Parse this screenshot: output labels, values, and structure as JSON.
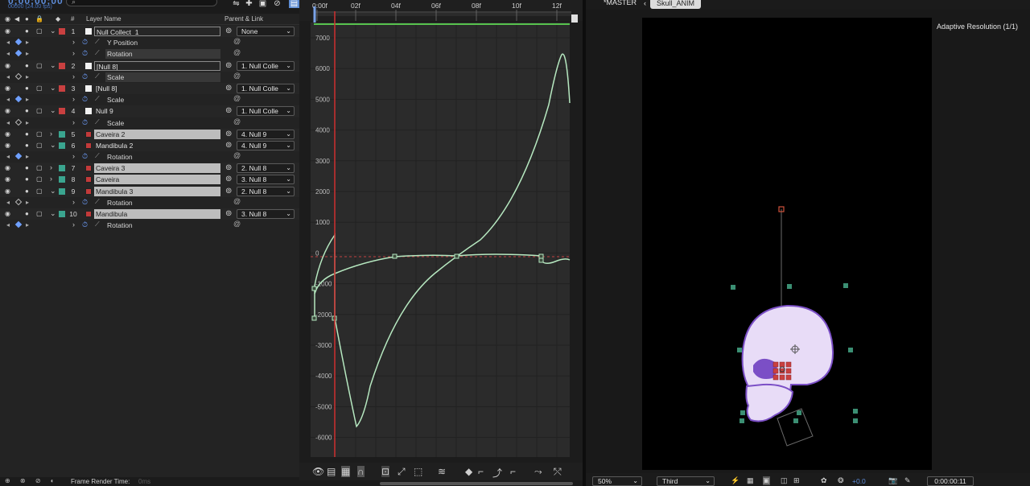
{
  "timeline": {
    "timecode": "0;00;00;00",
    "fps": "00000 (24.00 fps)",
    "search_placeholder": "",
    "search_icon_glyph": "⌕",
    "header": {
      "num": "#",
      "layer_name": "Layer Name",
      "parent_link": "Parent & Link"
    },
    "layers": [
      {
        "kind": "layer",
        "num": "1",
        "name": "Null Collect_1",
        "label_color": "#c94040",
        "type": "null",
        "expanded": true,
        "name_style": "boxed",
        "parent": "None"
      },
      {
        "kind": "prop",
        "name": "Y Position",
        "kf": "filled"
      },
      {
        "kind": "prop",
        "name": "Rotation",
        "kf": "filled",
        "dark": true
      },
      {
        "kind": "layer",
        "num": "2",
        "name": "[Null 8]",
        "label_color": "#c94040",
        "type": "null",
        "expanded": true,
        "name_style": "boxed",
        "parent": "1. Null Colle"
      },
      {
        "kind": "prop",
        "name": "Scale",
        "kf": "hollow",
        "dark": true
      },
      {
        "kind": "layer",
        "num": "3",
        "name": "[Null 8]",
        "label_color": "#c94040",
        "type": "null",
        "expanded": true,
        "name_style": "plain",
        "parent": "1. Null Colle"
      },
      {
        "kind": "prop",
        "name": "Scale",
        "kf": "filled"
      },
      {
        "kind": "layer",
        "num": "4",
        "name": "Null 9",
        "label_color": "#c94040",
        "type": "null",
        "expanded": true,
        "name_style": "plain",
        "parent": "1. Null Colle"
      },
      {
        "kind": "prop",
        "name": "Scale",
        "kf": "hollow"
      },
      {
        "kind": "layer",
        "num": "5",
        "name": "Caveira 2",
        "label_color": "#3aa58f",
        "type": "av",
        "expanded": false,
        "name_style": "selected",
        "parent": "4. Null 9"
      },
      {
        "kind": "layer",
        "num": "6",
        "name": "Mandibula 2",
        "label_color": "#3aa58f",
        "type": "av",
        "expanded": true,
        "name_style": "plain",
        "parent": "4. Null 9"
      },
      {
        "kind": "prop",
        "name": "Rotation",
        "kf": "filled"
      },
      {
        "kind": "layer",
        "num": "7",
        "name": "Caveira 3",
        "label_color": "#3aa58f",
        "type": "av",
        "expanded": false,
        "name_style": "selected",
        "parent": "2. Null 8"
      },
      {
        "kind": "layer",
        "num": "8",
        "name": "Caveira",
        "label_color": "#3aa58f",
        "type": "av",
        "expanded": false,
        "name_style": "selected",
        "parent": "3. Null 8"
      },
      {
        "kind": "layer",
        "num": "9",
        "name": "Mandibula 3",
        "label_color": "#3aa58f",
        "type": "av",
        "expanded": true,
        "name_style": "selected",
        "parent": "2. Null 8"
      },
      {
        "kind": "prop",
        "name": "Rotation",
        "kf": "hollow"
      },
      {
        "kind": "layer",
        "num": "10",
        "name": "Mandibula",
        "label_color": "#3aa58f",
        "type": "av",
        "expanded": true,
        "name_style": "selected",
        "parent": "3. Null 8"
      },
      {
        "kind": "prop",
        "name": "Rotation",
        "kf": "filled"
      }
    ],
    "render_time_label": "Frame Render Time:",
    "render_time_value": "0ms"
  },
  "graph_editor": {
    "ruler_labels": [
      "0:00f",
      "02f",
      "04f",
      "06f",
      "08f",
      "10f",
      "12f"
    ],
    "y_labels": [
      "7000",
      "6000",
      "5000",
      "4000",
      "3000",
      "2000",
      "1000",
      "0",
      "-1000",
      "-2000",
      "-3000",
      "-4000",
      "-5000",
      "-6000"
    ],
    "playhead_color": "#d03030",
    "curve_color": "#b6e8c0",
    "toolbar_icons": [
      "eye-icon",
      "graph-type-icon",
      "snap-icon",
      "magnet-icon",
      "fit-selection-icon",
      "fit-all-icon",
      "separate-dimensions-icon",
      "edit-keyframe-icon",
      "convert-hold-icon",
      "convert-linear-icon",
      "convert-auto-icon",
      "easy-ease-icon",
      "ease-in-icon",
      "ease-out-icon"
    ]
  },
  "viewer": {
    "tabs": [
      {
        "label": "*MASTER",
        "active": false
      },
      {
        "label": "Skull_ANIM",
        "active": true
      }
    ],
    "adaptive_resolution": "Adaptive Resolution (1/1)",
    "zoom": "50%",
    "resolution": "Third",
    "exposure": "+0.0",
    "current_time": "0:00:00:11",
    "skull_fill": "#e8dcf7",
    "skull_outline": "#7b4fc6"
  }
}
